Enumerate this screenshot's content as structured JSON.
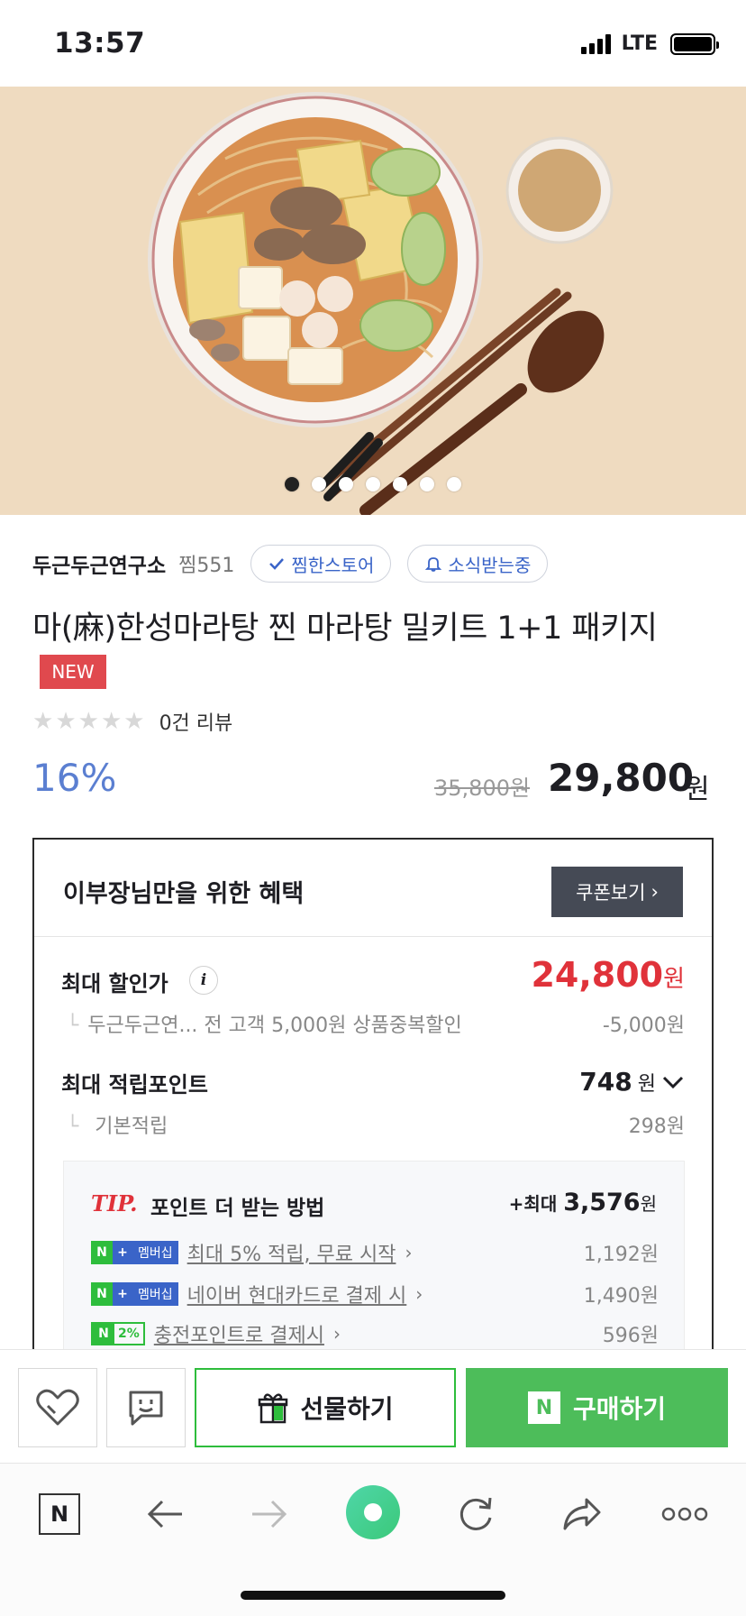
{
  "status_bar": {
    "time": "13:57",
    "network": "LTE"
  },
  "gallery": {
    "image_count": 7,
    "active_index": 0
  },
  "store": {
    "name": "두근두근연구소",
    "favorites": "찜551",
    "favorited_label": "찜한스토어",
    "notify_label": "소식받는중"
  },
  "product": {
    "title": "마(麻)한성마라탕 찐 마라탕 밀키트 1+1 패키지",
    "badge": "NEW",
    "rating": 0,
    "review_label": "0건 리뷰",
    "discount_rate": "16%",
    "original_price": "35,800원",
    "sale_price": "29,800",
    "currency": "원"
  },
  "benefit": {
    "title": "이부장님만을 위한 혜택",
    "coupon_button": "쿠폰보기",
    "max_discount_label": "최대 할인가",
    "max_discount_price": "24,800",
    "currency": "원",
    "discount_detail": "두근두근연... 전 고객 5,000원 상품중복할인",
    "discount_detail_amount": "-5,000원",
    "max_points_label": "최대 적립포인트",
    "max_points": "748",
    "basic_points_label": "기본적립",
    "basic_points": "298원",
    "tip": {
      "label": "TIP.",
      "text": "포인트 더 받는 방법",
      "max_prefix": "+최대",
      "max_value": "3,576",
      "currency": "원",
      "rows": [
        {
          "tag_n": "N",
          "tag_plus": "+",
          "tag_text": "멤버십",
          "link": "최대 5% 적립, 무료 시작",
          "amount": "1,192원"
        },
        {
          "tag_n": "N",
          "tag_plus": "+",
          "tag_text": "멤버십",
          "link": "네이버 현대카드로 결제 시",
          "amount": "1,490원"
        },
        {
          "tag_n": "N",
          "tag_pct": "2%",
          "link": "충전포인트로 결제시",
          "amount": "596원"
        }
      ]
    }
  },
  "actions": {
    "gift_label": "선물하기",
    "buy_n": "N",
    "buy_label": "구매하기"
  },
  "browser": {
    "home_logo": "N"
  },
  "colors": {
    "accent_blue": "#5b7fd1",
    "sale_red": "#e0323a",
    "naver_green": "#4dbd5a"
  }
}
